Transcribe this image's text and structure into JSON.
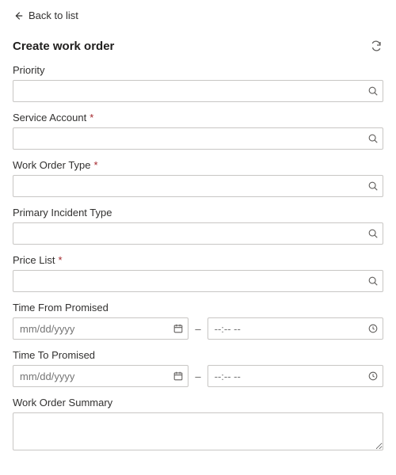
{
  "nav": {
    "back_label": "Back to list"
  },
  "header": {
    "title": "Create work order"
  },
  "fields": {
    "priority": {
      "label": "Priority",
      "required": false,
      "value": ""
    },
    "serviceAccount": {
      "label": "Service Account",
      "required": true,
      "value": ""
    },
    "workOrderType": {
      "label": "Work Order Type",
      "required": true,
      "value": ""
    },
    "incidentType": {
      "label": "Primary Incident Type",
      "required": false,
      "value": ""
    },
    "priceList": {
      "label": "Price List",
      "required": true,
      "value": ""
    },
    "timeFrom": {
      "label": "Time From Promised",
      "date_placeholder": "mm/dd/yyyy",
      "time_placeholder": "--:-- --",
      "date_value": "",
      "time_value": ""
    },
    "timeTo": {
      "label": "Time To Promised",
      "date_placeholder": "mm/dd/yyyy",
      "time_placeholder": "--:-- --",
      "date_value": "",
      "time_value": ""
    },
    "summary": {
      "label": "Work Order Summary",
      "value": ""
    }
  },
  "glyphs": {
    "required_marker": "*",
    "datetime_separator": "–"
  }
}
